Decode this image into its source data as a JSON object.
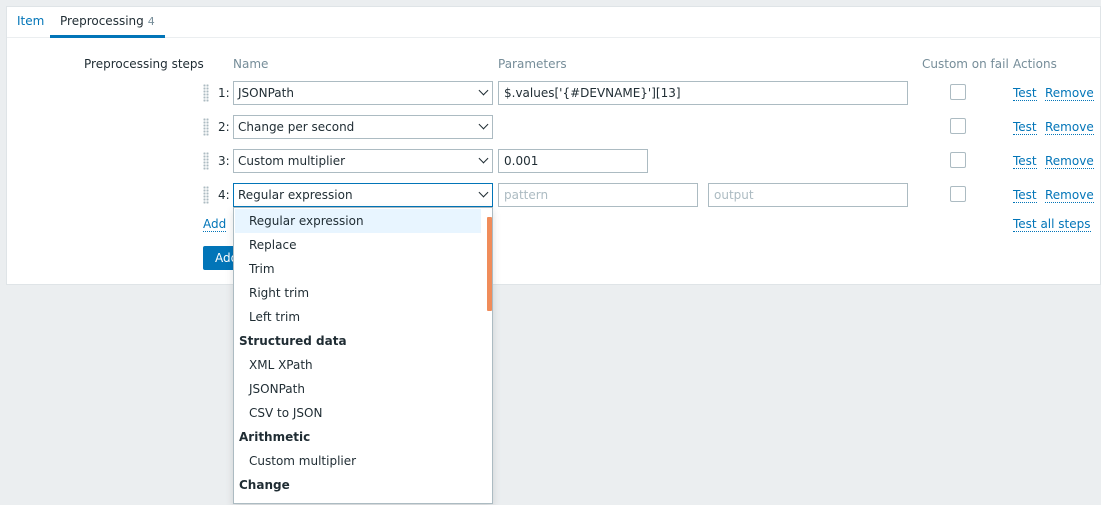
{
  "tabs": [
    {
      "label": "Item"
    },
    {
      "label": "Preprocessing",
      "count": "4"
    }
  ],
  "form": {
    "section_label": "Preprocessing steps",
    "headers": {
      "name": "Name",
      "parameters": "Parameters",
      "custom_on_fail": "Custom on fail",
      "actions": "Actions"
    },
    "steps": [
      {
        "num": "1:",
        "type": "JSONPath",
        "param1": "$.values['{#DEVNAME}'][13]",
        "custom_on_fail": false
      },
      {
        "num": "2:",
        "type": "Change per second",
        "custom_on_fail": false
      },
      {
        "num": "3:",
        "type": "Custom multiplier",
        "param1": "0.001",
        "custom_on_fail": false
      },
      {
        "num": "4:",
        "type": "Regular expression",
        "param1": "",
        "param1_placeholder": "pattern",
        "param2": "",
        "param2_placeholder": "output",
        "custom_on_fail": false
      }
    ],
    "action_test": "Test",
    "action_remove": "Remove",
    "add_link": "Add",
    "test_all_link": "Test all steps",
    "add_button": "Add"
  },
  "dropdown": {
    "items": [
      {
        "kind": "option",
        "label": "Regular expression",
        "selected": true
      },
      {
        "kind": "option",
        "label": "Replace"
      },
      {
        "kind": "option",
        "label": "Trim"
      },
      {
        "kind": "option",
        "label": "Right trim"
      },
      {
        "kind": "option",
        "label": "Left trim"
      },
      {
        "kind": "group",
        "label": "Structured data"
      },
      {
        "kind": "option",
        "label": "XML XPath"
      },
      {
        "kind": "option",
        "label": "JSONPath"
      },
      {
        "kind": "option",
        "label": "CSV to JSON"
      },
      {
        "kind": "group",
        "label": "Arithmetic"
      },
      {
        "kind": "option",
        "label": "Custom multiplier"
      },
      {
        "kind": "group",
        "label": "Change"
      }
    ]
  },
  "colors": {
    "accent": "#0275b8",
    "scrollbar": "#f08c5a",
    "background": "#ebeef0",
    "selected_option": "#e8f5ff"
  },
  "icons": {
    "drag_handle": "drag-handle-icon",
    "select_arrow": "chevron-down-icon"
  }
}
